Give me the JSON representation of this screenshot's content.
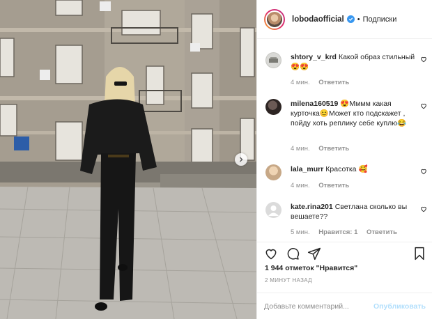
{
  "post": {
    "author": "lobodaofficial",
    "separator": "•",
    "follow_label": "Подписки"
  },
  "comments": [
    {
      "user": "shtory_v_krd",
      "text": "Какой образ стильный😍😍",
      "time": "4 мин.",
      "reply": "Ответить",
      "likes": ""
    },
    {
      "user": "milena160519",
      "text": "😍Мммм какая курточка😊Может кто подскажет , пойду хоть реплику себе куплю😂",
      "time": "4 мин.",
      "reply": "Ответить",
      "likes": ""
    },
    {
      "user": "lala_murr",
      "text": "Красотка 🥰",
      "time": "4 мин.",
      "reply": "Ответить",
      "likes": ""
    },
    {
      "user": "kate.rina201",
      "text": "Светлана сколько вы вешаете??",
      "time": "5 мин.",
      "reply": "Ответить",
      "likes": "Нравится: 1"
    }
  ],
  "likes_text": "1 944 отметок \"Нравится\"",
  "time_ago": "2 МИНУТ НАЗАД",
  "add_comment": {
    "placeholder": "Добавьте комментарий...",
    "publish_label": "Опубликовать"
  },
  "icons": {
    "verified": "verified-badge-icon",
    "like": "heart-icon",
    "comment": "comment-icon",
    "share": "share-icon",
    "save": "bookmark-icon"
  },
  "colors": {
    "verified": "#3897f0",
    "publish_disabled": "#b2dffc",
    "meta_text": "#8e8e8e"
  }
}
